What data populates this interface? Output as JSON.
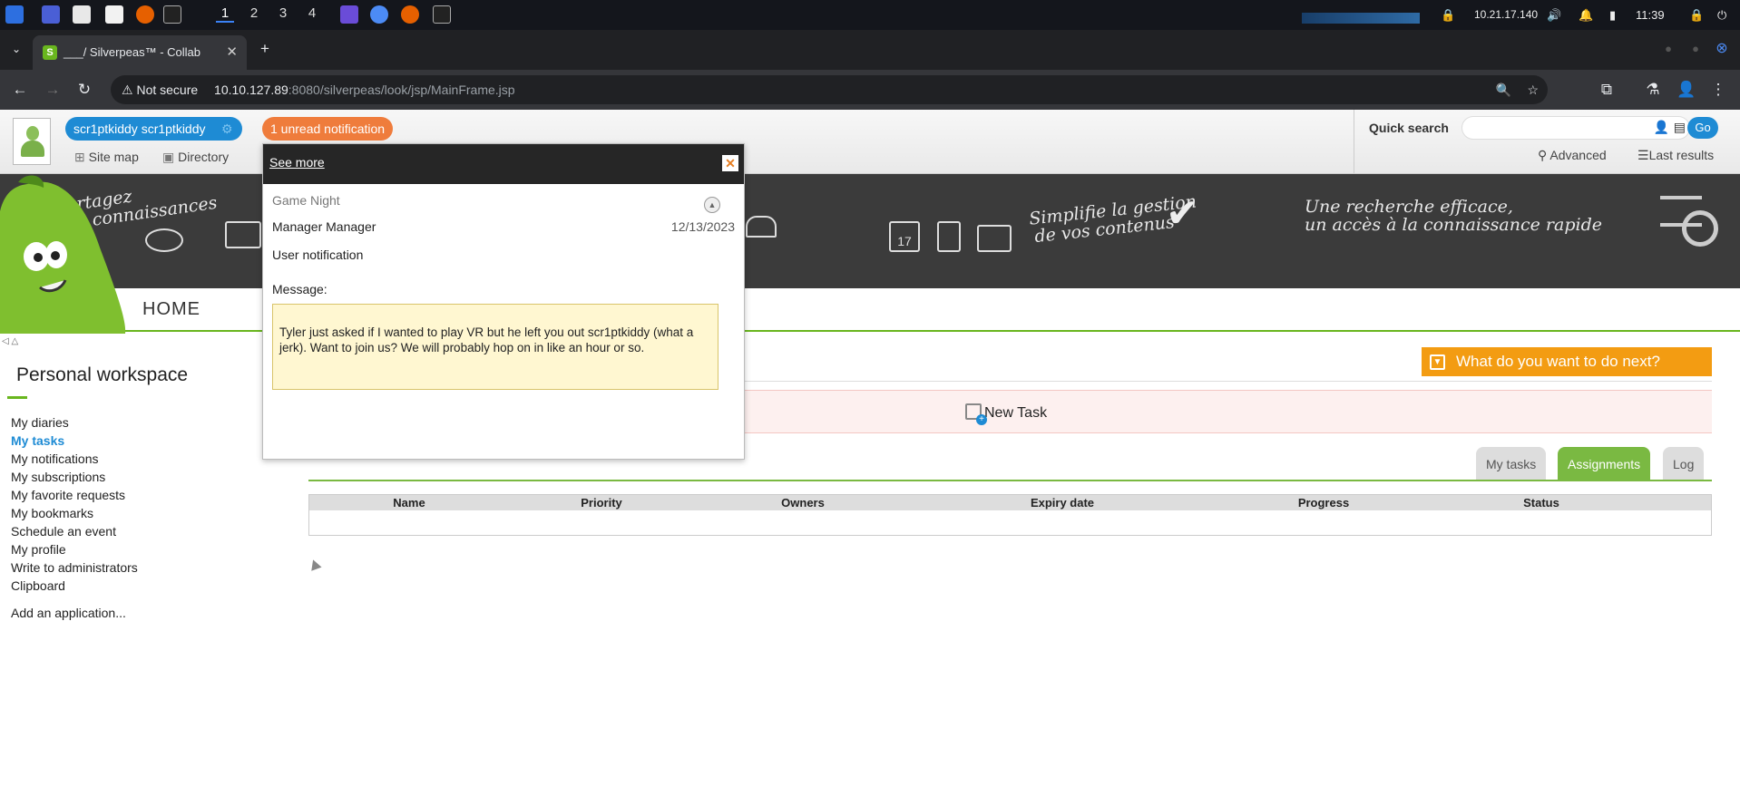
{
  "taskbar": {
    "workspaces": [
      "1",
      "2",
      "3",
      "4"
    ],
    "ip": "10.21.17.140",
    "time": "11:39"
  },
  "browser": {
    "tab_title": "___/ Silverpeas™ - Collab",
    "not_secure": "Not secure",
    "url_host": "10.10.127.89",
    "url_path": ":8080/silverpeas/look/jsp/MainFrame.jsp"
  },
  "header": {
    "user_name": "scr1ptkiddy scr1ptkiddy",
    "notifications": "1 unread notification",
    "site_map": "Site map",
    "directory": "Directory"
  },
  "search": {
    "label": "Quick search",
    "go": "Go",
    "advanced": "Advanced",
    "last_results": "Last results"
  },
  "banner": {
    "text1_line1": "Partagez",
    "text1_line2": "vos connaissances",
    "text2_line1": "Simplifie la gestion",
    "text2_line2": "de vos contenus",
    "text3_line1": "Une recherche efficace,",
    "text3_line2": "un accès à la connaissance rapide",
    "calendar_day": "17"
  },
  "menu": {
    "home": "HOME"
  },
  "workspace": {
    "title": "Personal workspace",
    "items": [
      "My diaries",
      "My tasks",
      "My notifications",
      "My subscriptions",
      "My favorite requests",
      "My bookmarks",
      "Schedule an event",
      "My profile",
      "Write to administrators",
      "Clipboard"
    ],
    "add": "Add an application..."
  },
  "main": {
    "next": "What do you want to do next?",
    "new_task": "New Task",
    "tabs": [
      "My tasks",
      "Assignments",
      "Log"
    ],
    "columns": [
      "Name",
      "Priority",
      "Owners",
      "Expiry date",
      "Progress",
      "Status"
    ]
  },
  "popup": {
    "see_more": "See more",
    "subject": "Game Night",
    "sender": "Manager Manager",
    "date": "12/13/2023",
    "type": "User notification",
    "message_label": "Message:",
    "message": "Tyler just asked if I wanted to play VR but he left you out scr1ptkiddy (what a jerk). Want to join us? We will probably hop on in like an hour or so."
  }
}
